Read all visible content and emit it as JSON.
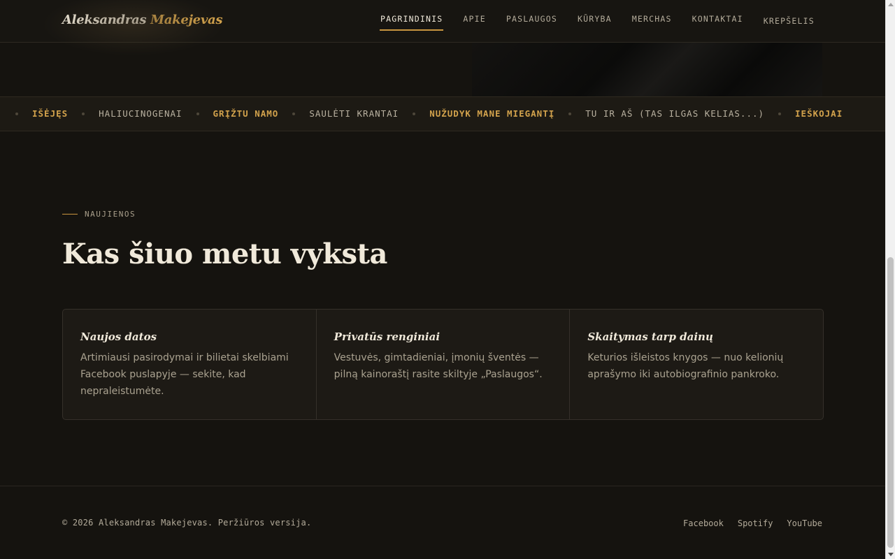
{
  "header": {
    "brand_first": "Aleksandras",
    "brand_second": "Makejevas",
    "nav": [
      "PAGRINDINIS",
      "APIE",
      "PASLAUGOS",
      "KŪRYBA",
      "MERCHAS",
      "KONTAKTAI",
      "KREPŠELIS"
    ],
    "active_nav": "PAGRINDINIS"
  },
  "ticker": [
    {
      "label": "IŠĖJĘS",
      "highlight": true
    },
    {
      "label": "HALIUCINOGENAI",
      "highlight": false
    },
    {
      "label": "GRĮŽTU NAMO",
      "highlight": true
    },
    {
      "label": "SAULĖTI KRANTAI",
      "highlight": false
    },
    {
      "label": "NUŽUDYK MANE MIEGANTĮ",
      "highlight": true
    },
    {
      "label": "TU IR AŠ (TAS ILGAS KELIAS...)",
      "highlight": false
    },
    {
      "label": "IEŠKOJAI",
      "highlight": true
    }
  ],
  "news": {
    "eyebrow": "NAUJIENOS",
    "title": "Kas šiuo metu vyksta",
    "cards": [
      {
        "title": "Naujos datos",
        "text": "Artimiausi pasirodymai ir bilietai skelbiami Facebook puslapyje — sekite, kad nepraleistumėte."
      },
      {
        "title": "Privatūs renginiai",
        "text": "Vestuvės, gimtadieniai, įmonių šventės — pilną kainoraštį rasite skiltyje „Paslaugos“."
      },
      {
        "title": "Skaitymas tarp dainų",
        "text": "Keturios išleistos knygos — nuo kelionių aprašymo iki autobiografinio pankroko."
      }
    ]
  },
  "footer": {
    "copyright": "© 2026 Aleksandras Makejevas. Peržiūros versija.",
    "links": [
      "Facebook",
      "Spotify",
      "YouTube"
    ]
  },
  "colors": {
    "background": "#15130f",
    "accent": "#d2a24c",
    "text": "#f0e9da"
  }
}
